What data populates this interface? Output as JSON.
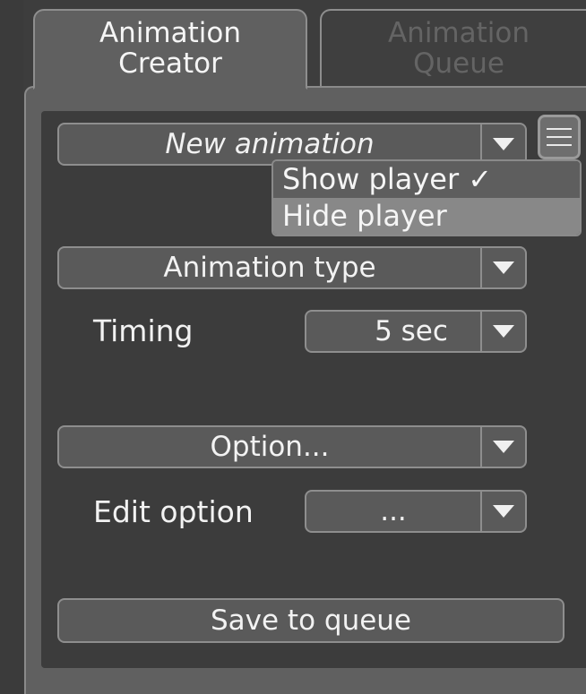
{
  "tabs": [
    {
      "label_line1": "Animation",
      "label_line2": "Creator",
      "active": true
    },
    {
      "label_line1": "Animation",
      "label_line2": "Queue",
      "active": false
    }
  ],
  "animation_select": {
    "value": "New animation"
  },
  "menu": {
    "items": [
      {
        "label": "Show player ✓",
        "checked": true
      },
      {
        "label": "Hide player",
        "checked": false
      }
    ]
  },
  "animation_type_select": {
    "value": "Animation type"
  },
  "timing": {
    "label": "Timing",
    "value": "5 sec"
  },
  "option_select": {
    "value": "Option..."
  },
  "edit_option": {
    "label": "Edit option",
    "value": "..."
  },
  "save_button": {
    "label": "Save to queue"
  },
  "icons": {
    "dropdown": "triangle-down-icon",
    "menu": "hamburger-icon"
  },
  "colors": {
    "background": "#3d3d3d",
    "panel": "#606060",
    "inner_panel": "#3c3c3c",
    "control": "#5a5a5a",
    "border": "#8e8e8e",
    "text": "#f2f2f2",
    "inactive_tab_text": "#646464"
  }
}
